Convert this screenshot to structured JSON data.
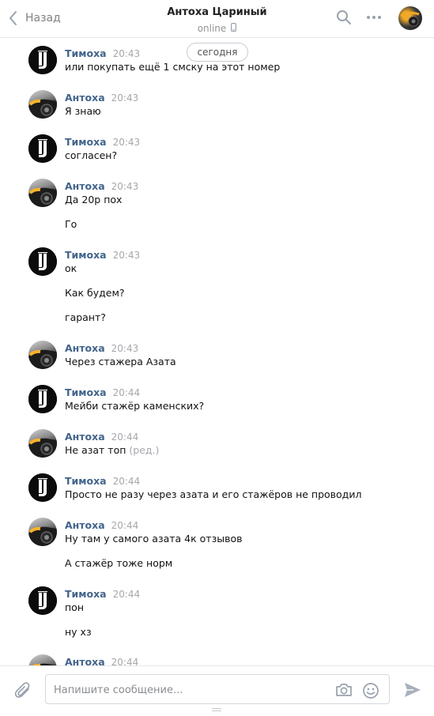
{
  "header": {
    "back_label": "Назад",
    "title": "Антоха Цариный",
    "status": "online"
  },
  "date_separator": "сегодня",
  "messages": [
    {
      "author": "Тимоха",
      "avatar": "juventus-logo",
      "time": "20:43",
      "lines": [
        "или покупать ещё 1 смску на этот номер"
      ]
    },
    {
      "author": "Антоха",
      "avatar": "car-photo",
      "time": "20:43",
      "lines": [
        "Я знаю"
      ]
    },
    {
      "author": "Тимоха",
      "avatar": "juventus-logo",
      "time": "20:43",
      "lines": [
        "согласен?"
      ]
    },
    {
      "author": "Антоха",
      "avatar": "car-photo",
      "time": "20:43",
      "lines": [
        "Да 20р пох",
        "Го"
      ]
    },
    {
      "author": "Тимоха",
      "avatar": "juventus-logo",
      "time": "20:43",
      "lines": [
        "ок",
        "Как будем?",
        "гарант?"
      ]
    },
    {
      "author": "Антоха",
      "avatar": "car-photo",
      "time": "20:43",
      "lines": [
        "Через стажера Азата"
      ]
    },
    {
      "author": "Тимоха",
      "avatar": "juventus-logo",
      "time": "20:44",
      "lines": [
        "Мейби стажёр каменских?"
      ]
    },
    {
      "author": "Антоха",
      "avatar": "car-photo",
      "time": "20:44",
      "lines": [
        "Не азат топ"
      ],
      "edited": "(ред.)"
    },
    {
      "author": "Тимоха",
      "avatar": "juventus-logo",
      "time": "20:44",
      "lines": [
        "Просто не разу через азата и его стажёров не проводил"
      ]
    },
    {
      "author": "Антоха",
      "avatar": "car-photo",
      "time": "20:44",
      "lines": [
        "Ну там у самого азата 4к отзывов",
        "А стажёр тоже норм"
      ]
    },
    {
      "author": "Тимоха",
      "avatar": "juventus-logo",
      "time": "20:44",
      "lines": [
        "пон",
        "ну хз"
      ]
    },
    {
      "author": "Антоха",
      "avatar": "car-photo",
      "time": "20:44",
      "lines": []
    }
  ],
  "composer": {
    "placeholder": "Напишите сообщение..."
  },
  "colors": {
    "author_name": "#42648b",
    "time": "#a5a7ab",
    "accent": "#5181b8"
  },
  "icons": [
    "back-chevron-icon",
    "search-icon",
    "more-icon",
    "mobile-icon",
    "paperclip-icon",
    "camera-icon",
    "smile-icon",
    "send-icon"
  ]
}
